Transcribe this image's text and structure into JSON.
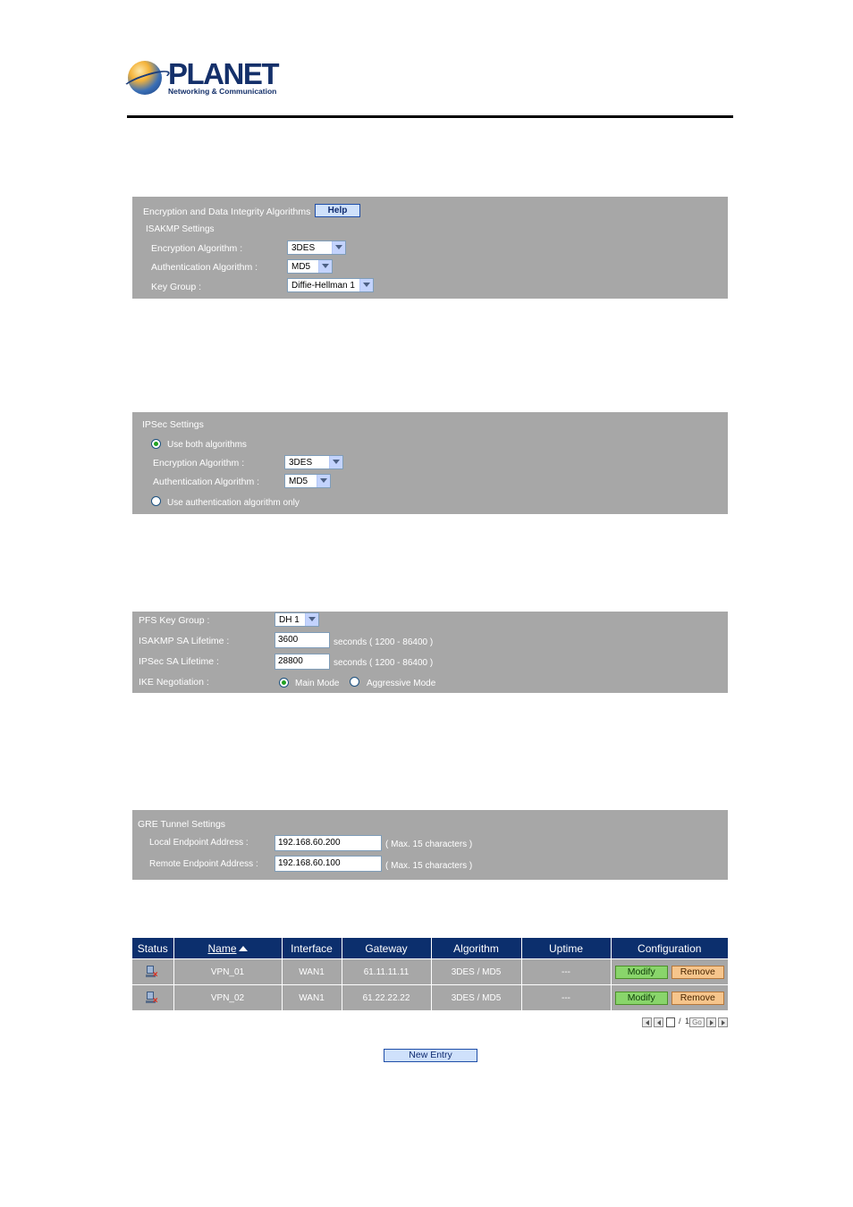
{
  "logo": {
    "name": "PLANET",
    "tagline": "Networking & Communication"
  },
  "isakmp_panel": {
    "title": "Encryption and Data Integrity Algorithms",
    "help_label": "Help",
    "section": "ISAKMP Settings",
    "encryption_label": "Encryption Algorithm :",
    "encryption_value": "3DES",
    "authentication_label": "Authentication Algorithm :",
    "authentication_value": "MD5",
    "keygroup_label": "Key Group :",
    "keygroup_value": "Diffie-Hellman 1"
  },
  "ipsec_panel": {
    "title": "IPSec Settings",
    "use_both_label": "Use both algorithms",
    "use_both_selected": true,
    "encryption_label": "Encryption Algorithm :",
    "encryption_value": "3DES",
    "authentication_label": "Authentication Algorithm :",
    "authentication_value": "MD5",
    "auth_only_label": "Use authentication algorithm only",
    "auth_only_selected": false
  },
  "sa_panel": {
    "pfs_label": "PFS Key Group :",
    "pfs_value": "DH 1",
    "isakmp_lifetime_label": "ISAKMP SA Lifetime :",
    "isakmp_lifetime_value": "3600",
    "isakmp_lifetime_hint": "seconds ( 1200 - 86400 )",
    "ipsec_lifetime_label": "IPSec SA Lifetime :",
    "ipsec_lifetime_value": "28800",
    "ipsec_lifetime_hint": "seconds ( 1200 - 86400 )",
    "ike_label": "IKE Negotiation :",
    "main_mode_label": "Main Mode",
    "aggressive_mode_label": "Aggressive Mode",
    "selected_mode": "Main Mode"
  },
  "gre_panel": {
    "title": "GRE Tunnel Settings",
    "local_label": "Local Endpoint Address :",
    "local_value": "192.168.60.200",
    "local_hint": "( Max. 15 characters )",
    "remote_label": "Remote Endpoint Address :",
    "remote_value": "192.168.60.100",
    "remote_hint": "( Max. 15 characters )"
  },
  "vpn_table": {
    "headers": {
      "status": "Status",
      "name": "Name",
      "interface": "Interface",
      "gateway": "Gateway",
      "algorithm": "Algorithm",
      "uptime": "Uptime",
      "configuration": "Configuration"
    },
    "modify_label": "Modify",
    "remove_label": "Remove",
    "rows": [
      {
        "name": "VPN_01",
        "interface": "WAN1",
        "gateway": "61.11.11.11",
        "algorithm": "3DES / MD5",
        "uptime": "---",
        "status_icon": "disconnected-pc-icon"
      },
      {
        "name": "VPN_02",
        "interface": "WAN1",
        "gateway": "61.22.22.22",
        "algorithm": "3DES / MD5",
        "uptime": "---",
        "status_icon": "disconnected-pc-icon"
      }
    ]
  },
  "pager": {
    "page": "1",
    "separator": "/",
    "total": "1",
    "go_label": "Go"
  },
  "new_entry_label": "New Entry"
}
